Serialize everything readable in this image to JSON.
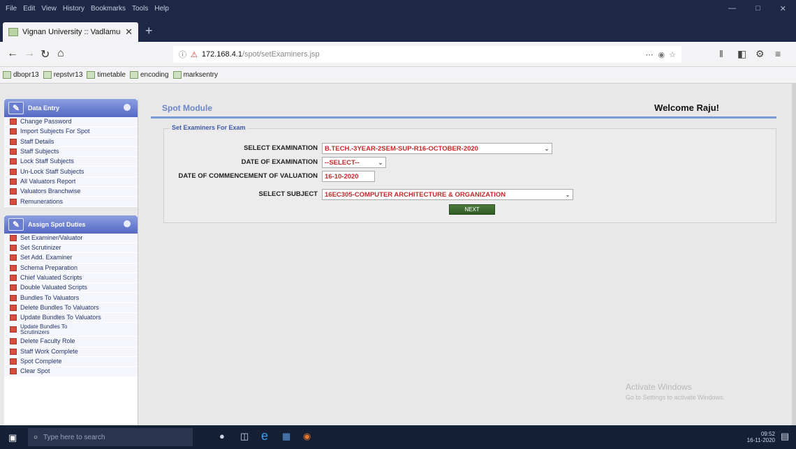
{
  "browser": {
    "menus": [
      "File",
      "Edit",
      "View",
      "History",
      "Bookmarks",
      "Tools",
      "Help"
    ],
    "tab_title": "Vignan University :: Vadlamudi",
    "url_host": "172.168.4.1",
    "url_path": "/spot/setExaminers.jsp",
    "bookmarks": [
      "dbopr13",
      "repstvr13",
      "timetable",
      "encoding",
      "marksentry"
    ]
  },
  "sidebar": {
    "data_entry": {
      "title": "Data Entry",
      "items": [
        "Change Password",
        "Import Subjects For Spot",
        "Staff Details",
        "Staff Subjects",
        "Lock Staff Subjects",
        "Un-Lock Staff Subjects",
        "All Valuators Report",
        "Valuators Branchwise",
        "Remunerations"
      ]
    },
    "assign": {
      "title": "Assign Spot Duties",
      "items": [
        "Set Examiner/Valuator",
        "Set Scrutinizer",
        "Set Add. Examiner",
        "Schema Preparation",
        "Chief Valuated Scripts",
        "Double Valuated Scripts",
        "Bundles To Valuators",
        "Delete Bundles To Valuators",
        "Update Bundles To Valuators",
        "Update Bundles To Scrutinizers",
        "Delete Faculty Role",
        "Staff Work Complete",
        "Spot Complete",
        "Clear Spot"
      ]
    }
  },
  "header": {
    "module_title": "Spot Module",
    "welcome": "Welcome Raju!"
  },
  "form": {
    "legend": "Set Examiners For Exam",
    "examination_label": "SELECT EXAMINATION",
    "examination_value": "B.TECH.-3YEAR-2SEM-SUP-R16-OCTOBER-2020",
    "date_label": "DATE OF EXAMINATION",
    "date_value": "--SELECT--",
    "commencement_label": "DATE OF COMMENCEMENT OF VALUATION",
    "commencement_value": "16-10-2020",
    "subject_label": "SELECT SUBJECT",
    "subject_value": "16EC305-COMPUTER ARCHITECTURE & ORGANIZATION",
    "next_label": "NEXT"
  },
  "watermark": {
    "title": "Activate Windows",
    "subtitle": "Go to Settings to activate Windows."
  },
  "taskbar": {
    "search_placeholder": "Type here to search",
    "time": "09:52",
    "date": "16-11-2020"
  }
}
